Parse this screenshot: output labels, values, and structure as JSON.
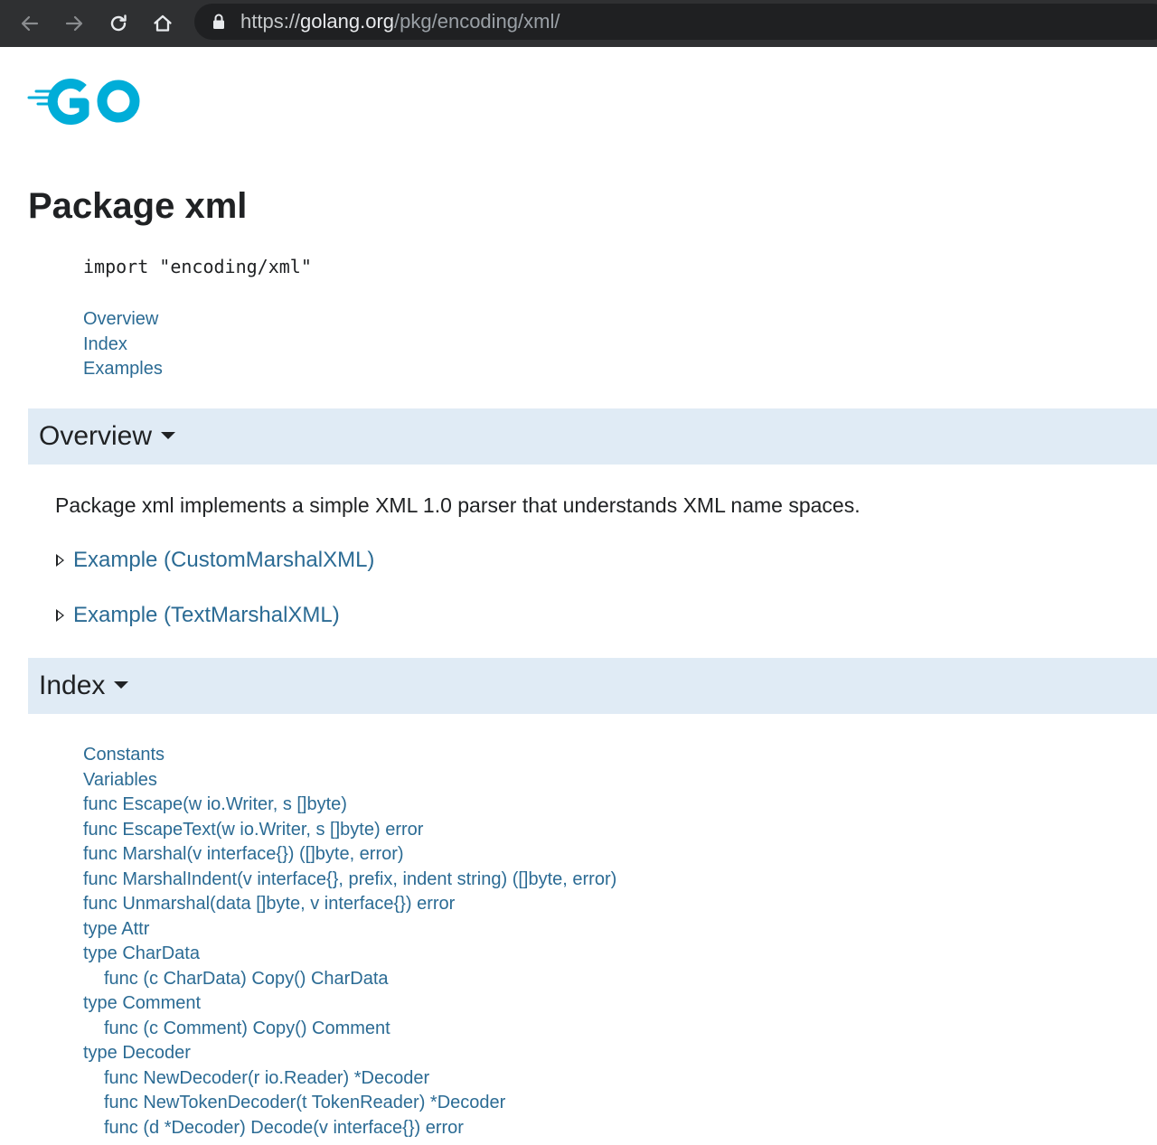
{
  "browser": {
    "url_scheme": "https://",
    "url_host": "golang.org",
    "url_path": "/pkg/encoding/xml/"
  },
  "colors": {
    "link": "#2b6b94",
    "section_bg": "#e0ebf5",
    "go_logo": "#00add8"
  },
  "header": {
    "logo": "go-logo"
  },
  "page": {
    "title": "Package xml",
    "import_line": "import \"encoding/xml\"",
    "toc": [
      "Overview",
      "Index",
      "Examples"
    ]
  },
  "overview": {
    "heading": "Overview",
    "text": "Package xml implements a simple XML 1.0 parser that understands XML name spaces.",
    "examples": [
      "Example (CustomMarshalXML)",
      "Example (TextMarshalXML)"
    ]
  },
  "index": {
    "heading": "Index",
    "items": [
      {
        "label": "Constants",
        "indent": false
      },
      {
        "label": "Variables",
        "indent": false
      },
      {
        "label": "func Escape(w io.Writer, s []byte)",
        "indent": false
      },
      {
        "label": "func EscapeText(w io.Writer, s []byte) error",
        "indent": false
      },
      {
        "label": "func Marshal(v interface{}) ([]byte, error)",
        "indent": false
      },
      {
        "label": "func MarshalIndent(v interface{}, prefix, indent string) ([]byte, error)",
        "indent": false
      },
      {
        "label": "func Unmarshal(data []byte, v interface{}) error",
        "indent": false
      },
      {
        "label": "type Attr",
        "indent": false
      },
      {
        "label": "type CharData",
        "indent": false
      },
      {
        "label": "func (c CharData) Copy() CharData",
        "indent": true
      },
      {
        "label": "type Comment",
        "indent": false
      },
      {
        "label": "func (c Comment) Copy() Comment",
        "indent": true
      },
      {
        "label": "type Decoder",
        "indent": false
      },
      {
        "label": "func NewDecoder(r io.Reader) *Decoder",
        "indent": true
      },
      {
        "label": "func NewTokenDecoder(t TokenReader) *Decoder",
        "indent": true
      },
      {
        "label": "func (d *Decoder) Decode(v interface{}) error",
        "indent": true
      }
    ]
  }
}
